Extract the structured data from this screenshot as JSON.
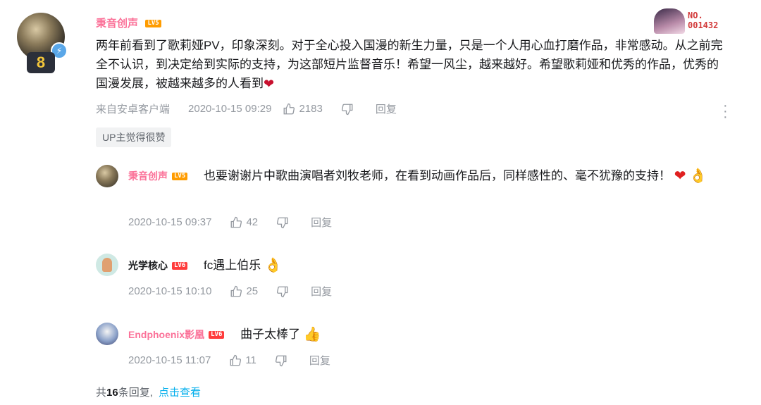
{
  "main_comment": {
    "user": "秉音创声",
    "level": "LV5",
    "nameplate": {
      "label": "NO.",
      "number": "001432"
    },
    "text": "两年前看到了歌莉娅PV，印象深刻。对于全心投入国漫的新生力量，只是一个人用心血打磨作品，非常感动。从之前完全不认识，到决定给到实际的支持，为这部短片监督音乐！希望一风尘，越来越好。希望歌莉娅和优秀的作品，优秀的国漫发展，被越来越多的人看到",
    "source": "来自安卓客户端",
    "time": "2020-10-15 09:29",
    "likes": "2183",
    "reply_label": "回复",
    "up_tag": "UP主觉得很赞"
  },
  "replies": [
    {
      "user": "秉音创声",
      "level": "LV5",
      "name_color": "#fb7299",
      "text": "也要谢谢片中歌曲演唱者刘牧老师，在看到动画作品后，同样感性的、毫不犹豫的支持！",
      "time": "2020-10-15 09:37",
      "likes": "42",
      "reply_label": "回复"
    },
    {
      "user": "光学核心",
      "level": "LV6",
      "name_color": "#18191c",
      "text": "fc遇上伯乐",
      "time": "2020-10-15 10:10",
      "likes": "25",
      "reply_label": "回复"
    },
    {
      "user": "Endphoenix影凰",
      "level": "LV6",
      "name_color": "#fb7299",
      "text": "曲子太棒了",
      "time": "2020-10-15 11:07",
      "likes": "11",
      "reply_label": "回复"
    }
  ],
  "footer": {
    "prefix": "共",
    "count": "16",
    "suffix": "条回复,",
    "link": "点击查看"
  },
  "colors": {
    "username_vip": "#fb7299",
    "meta_gray": "#9499a0",
    "link_blue": "#00aeec",
    "lv5": "#ff9c00",
    "lv6": "#ff3c3c"
  }
}
